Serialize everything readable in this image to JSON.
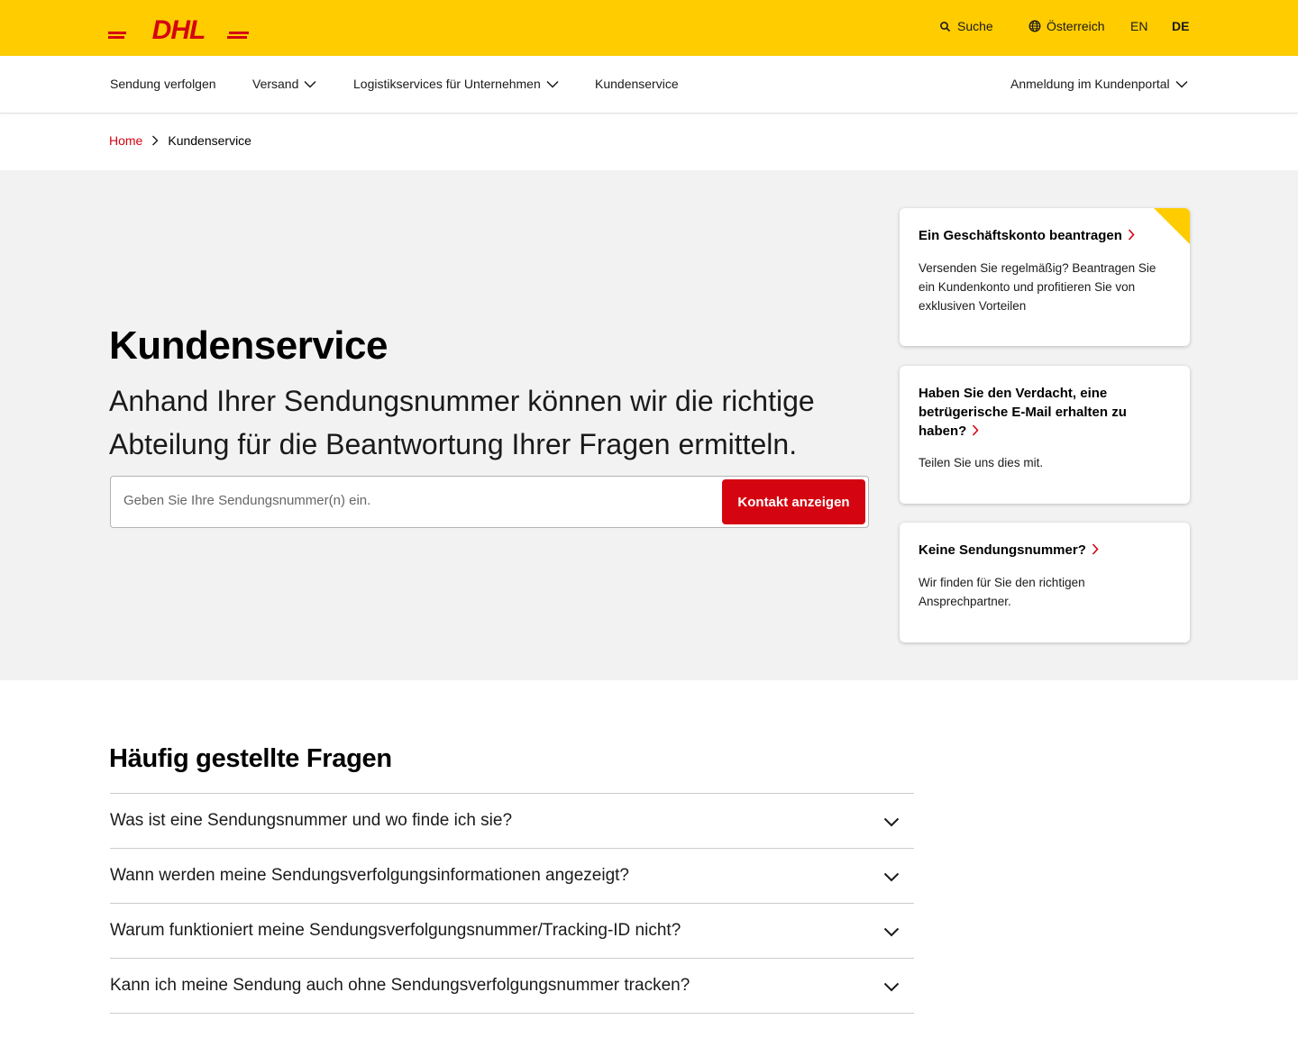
{
  "brand": {
    "logo_text": "DHL",
    "primary_color": "#ffcc00",
    "accent_color": "#d40511"
  },
  "utility": {
    "search_label": "Suche",
    "search_icon": "search-icon",
    "country_label": "Österreich",
    "country_icon": "globe-icon",
    "lang_en": "EN",
    "lang_de": "DE"
  },
  "nav": {
    "items": [
      {
        "label": "Sendung verfolgen",
        "has_dropdown": false
      },
      {
        "label": "Versand",
        "has_dropdown": true
      },
      {
        "label": "Logistikservices für Unternehmen",
        "has_dropdown": true
      },
      {
        "label": "Kundenservice",
        "has_dropdown": false
      }
    ],
    "portal_label": "Anmeldung im Kundenportal"
  },
  "breadcrumb": {
    "home": "Home",
    "current": "Kundenservice"
  },
  "hero": {
    "title": "Kundenservice",
    "subtitle": "Anhand Ihrer Sendungsnummer können wir die richtige Abteilung für die Beantwortung Ihrer Fragen ermitteln.",
    "input_placeholder": "Geben Sie Ihre Sendungsnummer(n) ein.",
    "button_label": "Kontakt anzeigen"
  },
  "cards": [
    {
      "title": "Ein Geschäftskonto beantragen",
      "text": "Versenden Sie regelmäßig? Beantragen Sie ein Kundenkonto und profitieren Sie von exklusiven Vorteilen"
    },
    {
      "title": "Haben Sie den Verdacht, eine betrügerische E-Mail erhalten zu haben?",
      "text": "Teilen Sie uns dies mit."
    },
    {
      "title": "Keine Sendungsnummer?",
      "text": "Wir finden für Sie den richtigen Ansprechpartner."
    }
  ],
  "faq": {
    "title": "Häufig gestellte Fragen",
    "items": [
      "Was ist eine Sendungsnummer und wo finde ich sie?",
      "Wann werden meine Sendungsverfolgungsinformationen angezeigt?",
      "Warum funktioniert meine Sendungsverfolgungsnummer/Tracking-ID nicht?",
      "Kann ich meine Sendung auch ohne Sendungsverfolgungsnummer tracken?"
    ]
  }
}
